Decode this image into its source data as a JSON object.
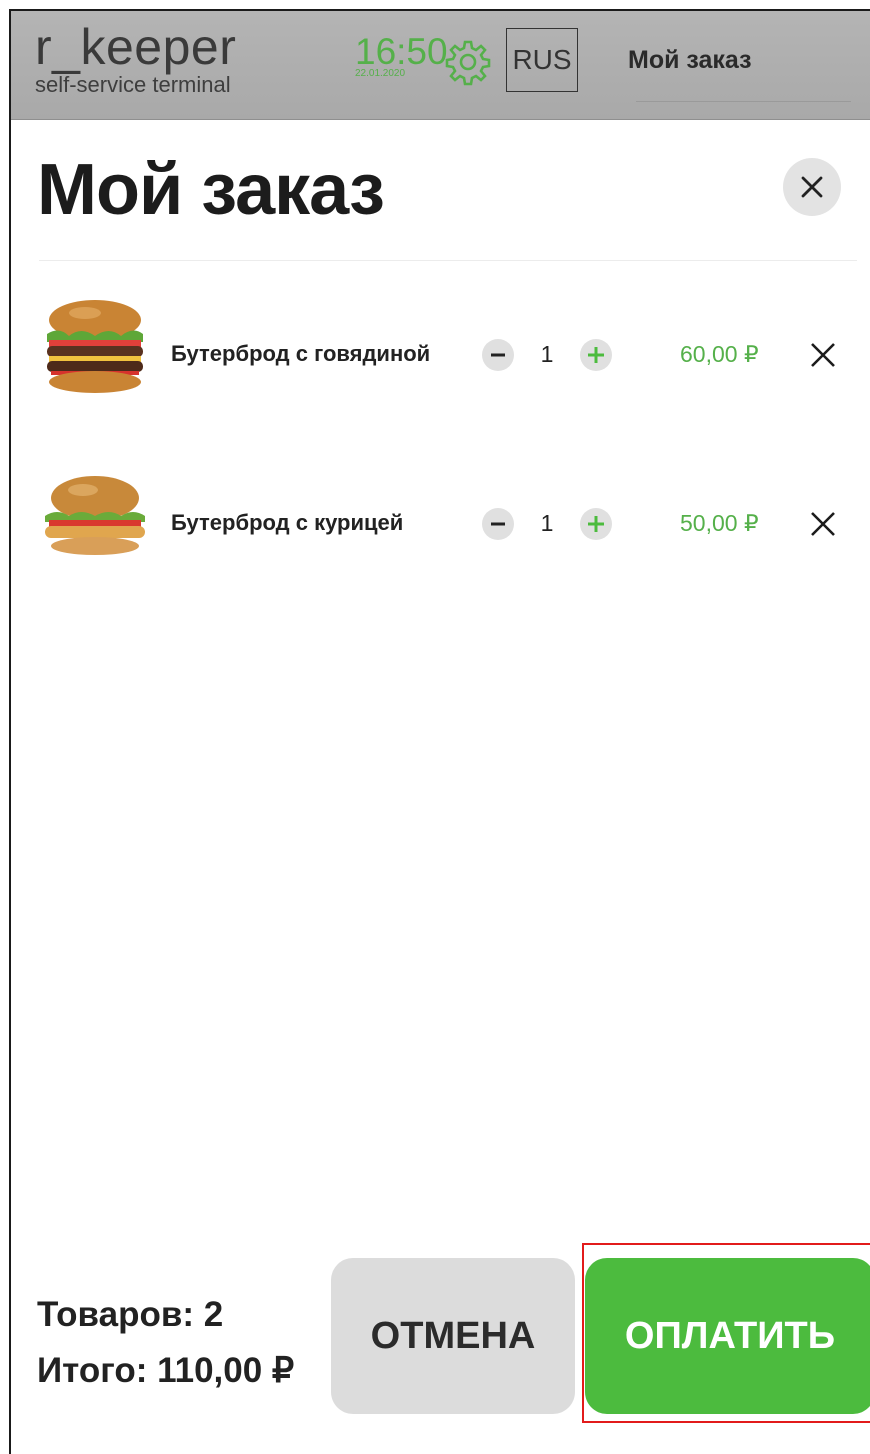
{
  "header": {
    "brand_name": "r_keeper",
    "brand_sub": "self-service terminal",
    "time": "16:50",
    "date": "22.01.2020",
    "settings_icon": "gear-icon",
    "language": "RUS",
    "tab_label": "Мой заказ"
  },
  "page": {
    "title": "Мой заказ",
    "close_icon": "close-icon"
  },
  "items": [
    {
      "name": "Бутерброд с говядиной",
      "qty": "1",
      "price": "60,00 ₽",
      "image": "beef-burger-image"
    },
    {
      "name": "Бутерброд с курицей",
      "qty": "1",
      "price": "50,00 ₽",
      "image": "chicken-burger-image"
    }
  ],
  "summary": {
    "count_label": "Товаров: 2",
    "total_label": "Итого: 110,00 ₽"
  },
  "buttons": {
    "cancel": "ОТМЕНА",
    "pay": "ОПЛАТИТЬ"
  },
  "colors": {
    "accent": "#4cbb3e",
    "price": "#55b04a",
    "header_bg": "#aeaeae",
    "highlight": "#e21b1b"
  }
}
